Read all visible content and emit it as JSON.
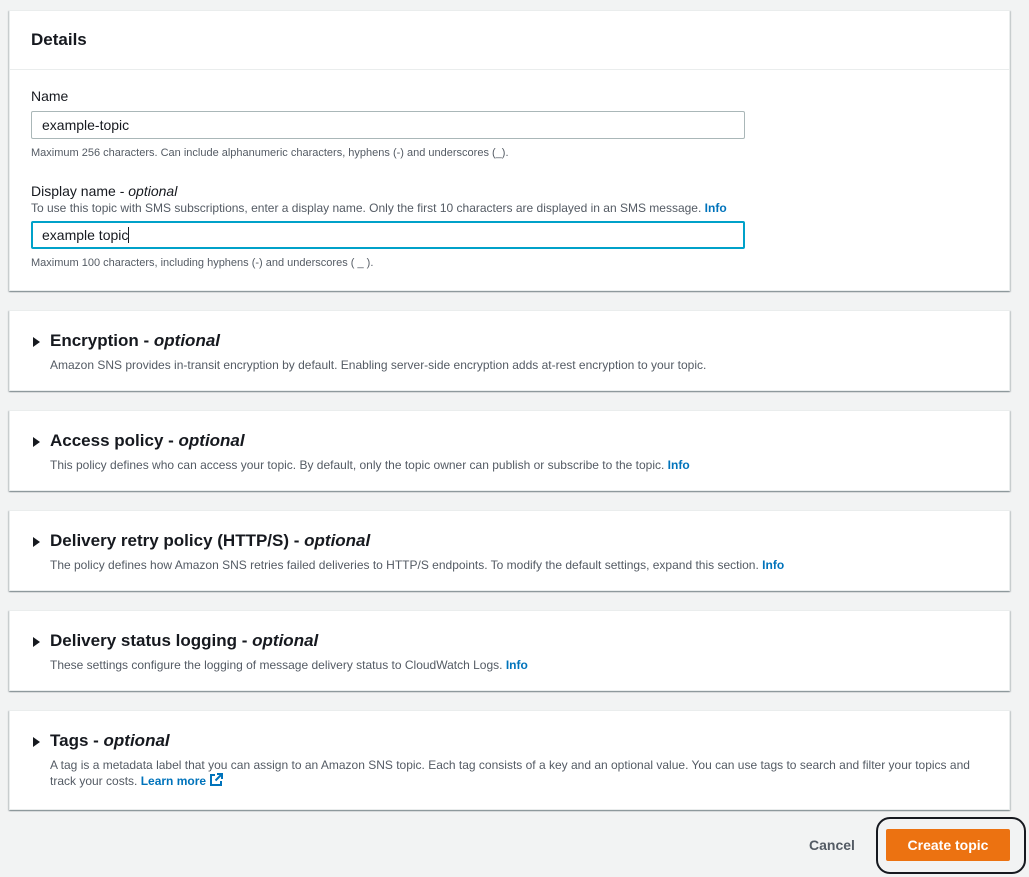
{
  "details": {
    "title": "Details",
    "name": {
      "label": "Name",
      "value": "example-topic",
      "constraint": "Maximum 256 characters. Can include alphanumeric characters, hyphens (-) and underscores (_)."
    },
    "display_name": {
      "label": "Display name - ",
      "label_optional": "optional",
      "description": "To use this topic with SMS subscriptions, enter a display name. Only the first 10 characters are displayed in an SMS message.",
      "info": "Info",
      "value": "example topic",
      "constraint": "Maximum 100 characters, including hyphens (-) and underscores ( _ )."
    }
  },
  "sections": {
    "encryption": {
      "title": "Encryption - ",
      "optional": "optional",
      "description": "Amazon SNS provides in-transit encryption by default. Enabling server-side encryption adds at-rest encryption to your topic."
    },
    "access_policy": {
      "title": "Access policy - ",
      "optional": "optional",
      "description": "This policy defines who can access your topic. By default, only the topic owner can publish or subscribe to the topic.",
      "info": "Info"
    },
    "retry_policy": {
      "title": "Delivery retry policy (HTTP/S) - ",
      "optional": "optional",
      "description": "The policy defines how Amazon SNS retries failed deliveries to HTTP/S endpoints. To modify the default settings, expand this section.",
      "info": "Info"
    },
    "status_logging": {
      "title": "Delivery status logging - ",
      "optional": "optional",
      "description": "These settings configure the logging of message delivery status to CloudWatch Logs.",
      "info": "Info"
    },
    "tags": {
      "title": "Tags - ",
      "optional": "optional",
      "description": "A tag is a metadata label that you can assign to an Amazon SNS topic. Each tag consists of a key and an optional value. You can use tags to search and filter your topics and track your costs.",
      "learn_more": "Learn more"
    }
  },
  "footer": {
    "cancel_label": "Cancel",
    "create_label": "Create topic"
  },
  "colors": {
    "primary_button": "#ec7211",
    "link": "#0073bb",
    "focus_border": "#00a1c9"
  }
}
